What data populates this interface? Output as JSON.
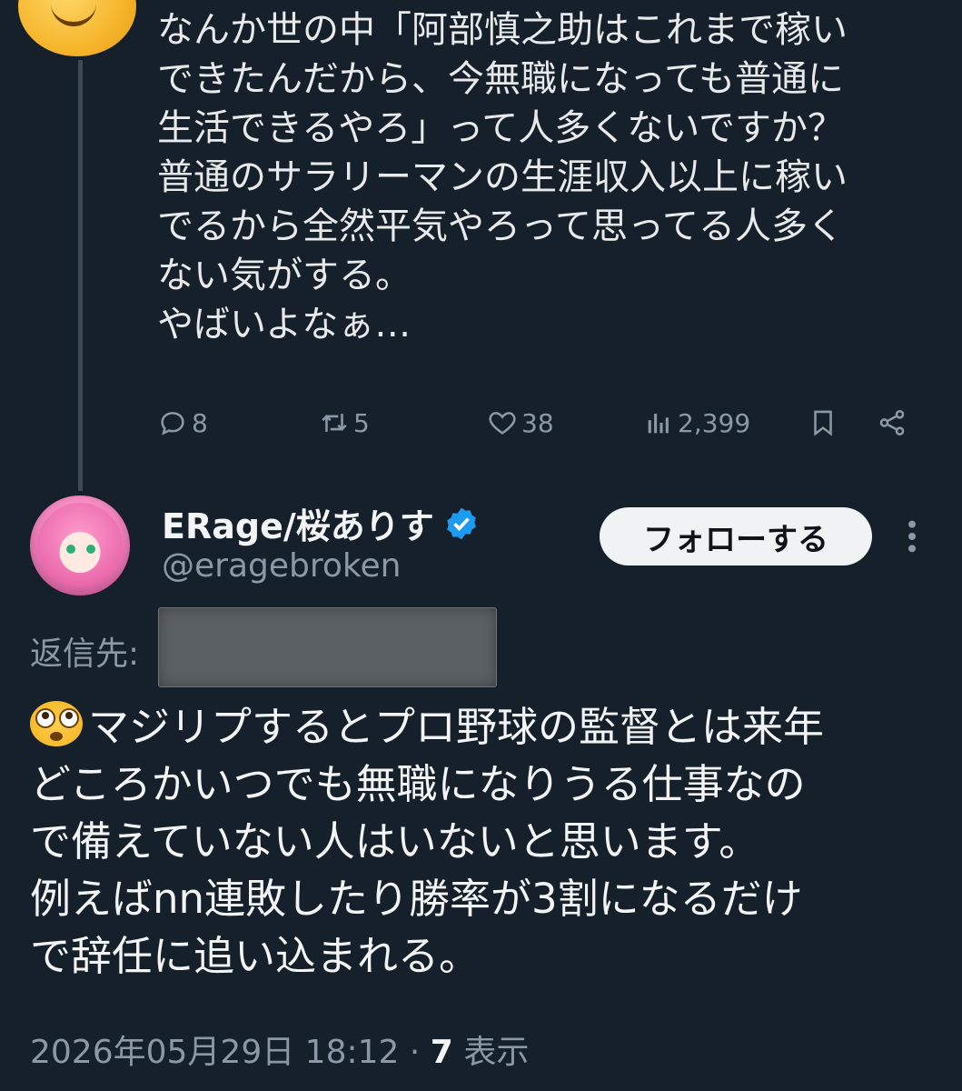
{
  "first_tweet": {
    "text": "なんか世の中「阿部慎之助はこれまで稼い\nできたんだから、今無職になっても普通に\n生活できるやろ」って人多くないですか？\n普通のサラリーマンの生涯収入以上に稼い\nでるから全然平気やろって思ってる人多く\nない気がする。\nやばいよなぁ…",
    "actions": {
      "replies": "8",
      "retweets": "5",
      "likes": "38",
      "views": "2,399"
    }
  },
  "reply_tweet": {
    "display_name": "ERage/桜ありす",
    "handle": "@eragebroken",
    "follow_label": "フォローする",
    "reply_to_label": "返信先:",
    "text": "マジリプするとプロ野球の監督とは来年\nどころかいつでも無職になりうる仕事なの\nで備えていない人はいないと思います。\n例えばnn連敗したり勝率が3割になるだけ\nで辞任に追い込まれる。",
    "timestamp": "2026年05月29日 18:12",
    "separator": "·",
    "view_count": "7",
    "view_label": "表示"
  },
  "colors": {
    "background": "#15202b",
    "text": "#e7e9ea",
    "muted": "#8b98a5",
    "verified": "#1d9bf0",
    "follow_button": "#eff3f4"
  }
}
